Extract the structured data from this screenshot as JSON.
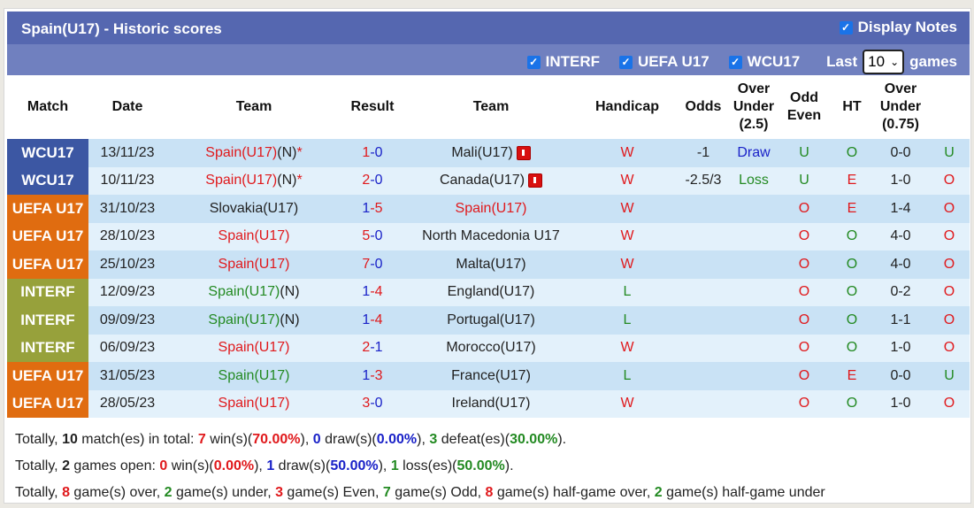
{
  "header": {
    "title": "Spain(U17) - Historic scores",
    "display_notes_label": "Display Notes",
    "display_notes_checked": true
  },
  "filters": {
    "items": [
      {
        "label": "INTERF",
        "checked": true
      },
      {
        "label": "UEFA U17",
        "checked": true
      },
      {
        "label": "WCU17",
        "checked": true
      }
    ],
    "last_label": "Last",
    "last_value": "10",
    "games_label": "games"
  },
  "columns": [
    "Match",
    "Date",
    "Team",
    "Result",
    "Team",
    "Handicap",
    "Odds",
    "Over Under (2.5)",
    "Odd Even",
    "HT",
    "Over Under (0.75)"
  ],
  "colors": {
    "WCU17": "#3c57a3",
    "UEFA U17": "#e06c10",
    "INTERF": "#97a13b"
  },
  "rows": [
    {
      "match": "WCU17",
      "date": "13/11/23",
      "home": "Spain(U17)",
      "home_suffix": "(N)",
      "home_mark": "*",
      "home_color": "red",
      "score_h": "1",
      "score_a": "0",
      "sh_color": "red",
      "sa_color": "blue",
      "away": "Mali(U17)",
      "away_color": "dark",
      "away_flag": true,
      "wl": "W",
      "wl_color": "red",
      "handicap": "-1",
      "odds": "Draw",
      "odds_color": "blue",
      "ou": "U",
      "ou_color": "green",
      "oe": "O",
      "oe_color": "green",
      "ht": "0-0",
      "ou2": "U",
      "ou2_color": "green"
    },
    {
      "match": "WCU17",
      "date": "10/11/23",
      "home": "Spain(U17)",
      "home_suffix": "(N)",
      "home_mark": "*",
      "home_color": "red",
      "score_h": "2",
      "score_a": "0",
      "sh_color": "red",
      "sa_color": "blue",
      "away": "Canada(U17)",
      "away_color": "dark",
      "away_flag": true,
      "wl": "W",
      "wl_color": "red",
      "handicap": "-2.5/3",
      "odds": "Loss",
      "odds_color": "green",
      "ou": "U",
      "ou_color": "green",
      "oe": "E",
      "oe_color": "red",
      "ht": "1-0",
      "ou2": "O",
      "ou2_color": "red"
    },
    {
      "match": "UEFA U17",
      "date": "31/10/23",
      "home": "Slovakia(U17)",
      "home_suffix": "",
      "home_mark": "",
      "home_color": "dark",
      "score_h": "1",
      "score_a": "5",
      "sh_color": "blue",
      "sa_color": "red",
      "away": "Spain(U17)",
      "away_color": "red",
      "away_flag": false,
      "wl": "W",
      "wl_color": "red",
      "handicap": "",
      "odds": "",
      "odds_color": "dark",
      "ou": "O",
      "ou_color": "red",
      "oe": "E",
      "oe_color": "red",
      "ht": "1-4",
      "ou2": "O",
      "ou2_color": "red"
    },
    {
      "match": "UEFA U17",
      "date": "28/10/23",
      "home": "Spain(U17)",
      "home_suffix": "",
      "home_mark": "",
      "home_color": "red",
      "score_h": "5",
      "score_a": "0",
      "sh_color": "red",
      "sa_color": "blue",
      "away": "North Macedonia U17",
      "away_color": "dark",
      "away_flag": false,
      "wl": "W",
      "wl_color": "red",
      "handicap": "",
      "odds": "",
      "odds_color": "dark",
      "ou": "O",
      "ou_color": "red",
      "oe": "O",
      "oe_color": "green",
      "ht": "4-0",
      "ou2": "O",
      "ou2_color": "red"
    },
    {
      "match": "UEFA U17",
      "date": "25/10/23",
      "home": "Spain(U17)",
      "home_suffix": "",
      "home_mark": "",
      "home_color": "red",
      "score_h": "7",
      "score_a": "0",
      "sh_color": "red",
      "sa_color": "blue",
      "away": "Malta(U17)",
      "away_color": "dark",
      "away_flag": false,
      "wl": "W",
      "wl_color": "red",
      "handicap": "",
      "odds": "",
      "odds_color": "dark",
      "ou": "O",
      "ou_color": "red",
      "oe": "O",
      "oe_color": "green",
      "ht": "4-0",
      "ou2": "O",
      "ou2_color": "red"
    },
    {
      "match": "INTERF",
      "date": "12/09/23",
      "home": "Spain(U17)",
      "home_suffix": "(N)",
      "home_mark": "",
      "home_color": "green",
      "score_h": "1",
      "score_a": "4",
      "sh_color": "blue",
      "sa_color": "red",
      "away": "England(U17)",
      "away_color": "dark",
      "away_flag": false,
      "wl": "L",
      "wl_color": "green",
      "handicap": "",
      "odds": "",
      "odds_color": "dark",
      "ou": "O",
      "ou_color": "red",
      "oe": "O",
      "oe_color": "green",
      "ht": "0-2",
      "ou2": "O",
      "ou2_color": "red"
    },
    {
      "match": "INTERF",
      "date": "09/09/23",
      "home": "Spain(U17)",
      "home_suffix": "(N)",
      "home_mark": "",
      "home_color": "green",
      "score_h": "1",
      "score_a": "4",
      "sh_color": "blue",
      "sa_color": "red",
      "away": "Portugal(U17)",
      "away_color": "dark",
      "away_flag": false,
      "wl": "L",
      "wl_color": "green",
      "handicap": "",
      "odds": "",
      "odds_color": "dark",
      "ou": "O",
      "ou_color": "red",
      "oe": "O",
      "oe_color": "green",
      "ht": "1-1",
      "ou2": "O",
      "ou2_color": "red"
    },
    {
      "match": "INTERF",
      "date": "06/09/23",
      "home": "Spain(U17)",
      "home_suffix": "",
      "home_mark": "",
      "home_color": "red",
      "score_h": "2",
      "score_a": "1",
      "sh_color": "red",
      "sa_color": "blue",
      "away": "Morocco(U17)",
      "away_color": "dark",
      "away_flag": false,
      "wl": "W",
      "wl_color": "red",
      "handicap": "",
      "odds": "",
      "odds_color": "dark",
      "ou": "O",
      "ou_color": "red",
      "oe": "O",
      "oe_color": "green",
      "ht": "1-0",
      "ou2": "O",
      "ou2_color": "red"
    },
    {
      "match": "UEFA U17",
      "date": "31/05/23",
      "home": "Spain(U17)",
      "home_suffix": "",
      "home_mark": "",
      "home_color": "green",
      "score_h": "1",
      "score_a": "3",
      "sh_color": "blue",
      "sa_color": "red",
      "away": "France(U17)",
      "away_color": "dark",
      "away_flag": false,
      "wl": "L",
      "wl_color": "green",
      "handicap": "",
      "odds": "",
      "odds_color": "dark",
      "ou": "O",
      "ou_color": "red",
      "oe": "E",
      "oe_color": "red",
      "ht": "0-0",
      "ou2": "U",
      "ou2_color": "green"
    },
    {
      "match": "UEFA U17",
      "date": "28/05/23",
      "home": "Spain(U17)",
      "home_suffix": "",
      "home_mark": "",
      "home_color": "red",
      "score_h": "3",
      "score_a": "0",
      "sh_color": "red",
      "sa_color": "blue",
      "away": "Ireland(U17)",
      "away_color": "dark",
      "away_flag": false,
      "wl": "W",
      "wl_color": "red",
      "handicap": "",
      "odds": "",
      "odds_color": "dark",
      "ou": "O",
      "ou_color": "red",
      "oe": "O",
      "oe_color": "green",
      "ht": "1-0",
      "ou2": "O",
      "ou2_color": "red"
    }
  ],
  "summary": [
    [
      [
        "Totally, ",
        "n"
      ],
      [
        "10",
        "b"
      ],
      [
        " match(es) in total: ",
        "n"
      ],
      [
        "7",
        "red"
      ],
      [
        " win(s)(",
        "n"
      ],
      [
        "70.00%",
        "red"
      ],
      [
        "), ",
        "n"
      ],
      [
        "0",
        "blue"
      ],
      [
        " draw(s)(",
        "n"
      ],
      [
        "0.00%",
        "blue"
      ],
      [
        "), ",
        "n"
      ],
      [
        "3",
        "green"
      ],
      [
        " defeat(es)(",
        "n"
      ],
      [
        "30.00%",
        "green"
      ],
      [
        ").",
        "n"
      ]
    ],
    [
      [
        "Totally, ",
        "n"
      ],
      [
        "2",
        "b"
      ],
      [
        " games open: ",
        "n"
      ],
      [
        "0",
        "red"
      ],
      [
        " win(s)(",
        "n"
      ],
      [
        "0.00%",
        "red"
      ],
      [
        "), ",
        "n"
      ],
      [
        "1",
        "blue"
      ],
      [
        " draw(s)(",
        "n"
      ],
      [
        "50.00%",
        "blue"
      ],
      [
        "), ",
        "n"
      ],
      [
        "1",
        "green"
      ],
      [
        " loss(es)(",
        "n"
      ],
      [
        "50.00%",
        "green"
      ],
      [
        ").",
        "n"
      ]
    ],
    [
      [
        "Totally, ",
        "n"
      ],
      [
        "8",
        "red"
      ],
      [
        " game(s) over, ",
        "n"
      ],
      [
        "2",
        "green"
      ],
      [
        " game(s) under, ",
        "n"
      ],
      [
        "3",
        "red"
      ],
      [
        " game(s) Even, ",
        "n"
      ],
      [
        "7",
        "green"
      ],
      [
        " game(s) Odd, ",
        "n"
      ],
      [
        "8",
        "red"
      ],
      [
        " game(s) half-game over, ",
        "n"
      ],
      [
        "2",
        "green"
      ],
      [
        " game(s) half-game under",
        "n"
      ]
    ]
  ]
}
